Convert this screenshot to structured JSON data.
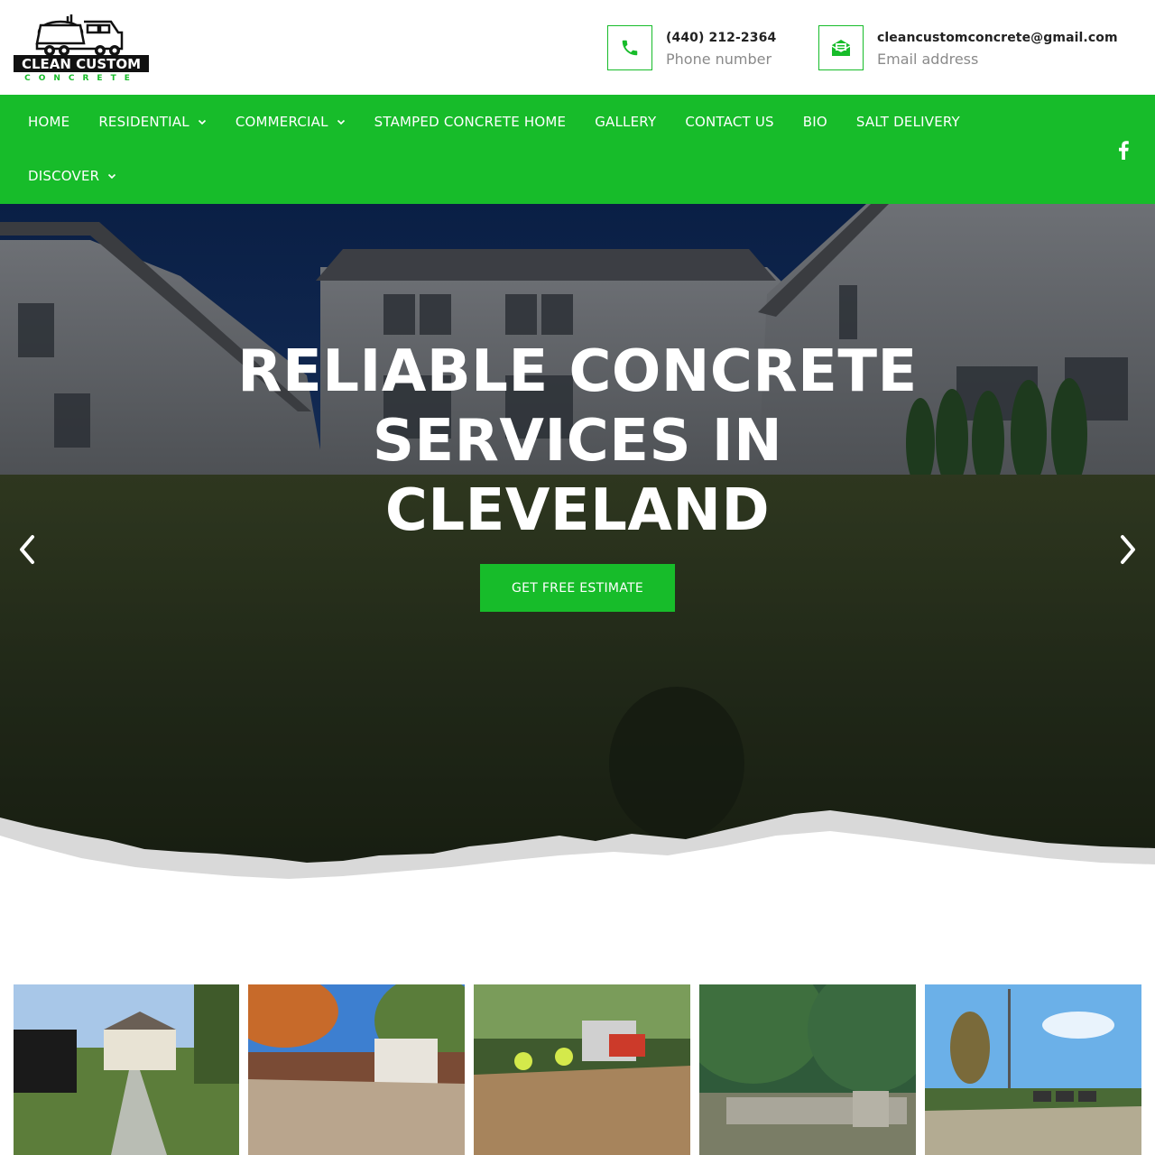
{
  "brand": {
    "logo_line1": "CLEAN CUSTOM",
    "logo_line2": "CONCRETE"
  },
  "contact": {
    "phone_value": "(440) 212-2364",
    "phone_label": "Phone number",
    "email_value": "cleancustomconcrete@gmail.com",
    "email_label": "Email address"
  },
  "nav": {
    "items": [
      {
        "label": "HOME",
        "has_dropdown": false
      },
      {
        "label": "RESIDENTIAL",
        "has_dropdown": true
      },
      {
        "label": "COMMERCIAL",
        "has_dropdown": true
      },
      {
        "label": "STAMPED CONCRETE HOME",
        "has_dropdown": false
      },
      {
        "label": "GALLERY",
        "has_dropdown": false
      },
      {
        "label": "CONTACT US",
        "has_dropdown": false
      },
      {
        "label": "BIO",
        "has_dropdown": false
      },
      {
        "label": "SALT DELIVERY",
        "has_dropdown": false
      },
      {
        "label": "DISCOVER",
        "has_dropdown": true
      }
    ],
    "social_icon": "facebook-icon"
  },
  "hero": {
    "title_line1": "RELIABLE CONCRETE",
    "title_line2": "SERVICES IN",
    "title_line3": "CLEVELAND",
    "cta_label": "GET FREE ESTIMATE",
    "prev_icon": "chevron-left-icon",
    "next_icon": "chevron-right-icon"
  },
  "colors": {
    "brand_green": "#17bc2a",
    "text_dark": "#222222",
    "text_muted": "#8a8a8a"
  },
  "gallery": {
    "images": [
      "driveway-photo",
      "patio-photo",
      "stamped-install-photo",
      "retaining-wall-photo",
      "parking-lot-photo"
    ]
  }
}
